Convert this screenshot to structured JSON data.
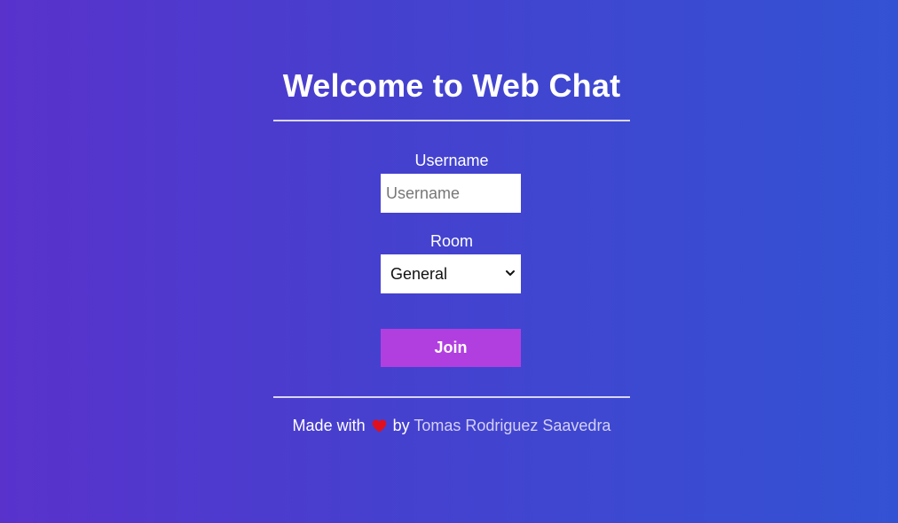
{
  "header": {
    "title": "Welcome to Web Chat"
  },
  "form": {
    "username_label": "Username",
    "username_placeholder": "Username",
    "username_value": "",
    "room_label": "Room",
    "room_selected": "General",
    "join_label": "Join"
  },
  "footer": {
    "made_with": "Made with",
    "by": "by",
    "author": "Tomas Rodriguez Saavedra",
    "heart_icon": "heart-icon"
  },
  "colors": {
    "background_start": "#5932cc",
    "background_end": "#3352d3",
    "join_button": "#b13fe0",
    "heart": "#e0101e",
    "link": "#d4d0f5"
  }
}
